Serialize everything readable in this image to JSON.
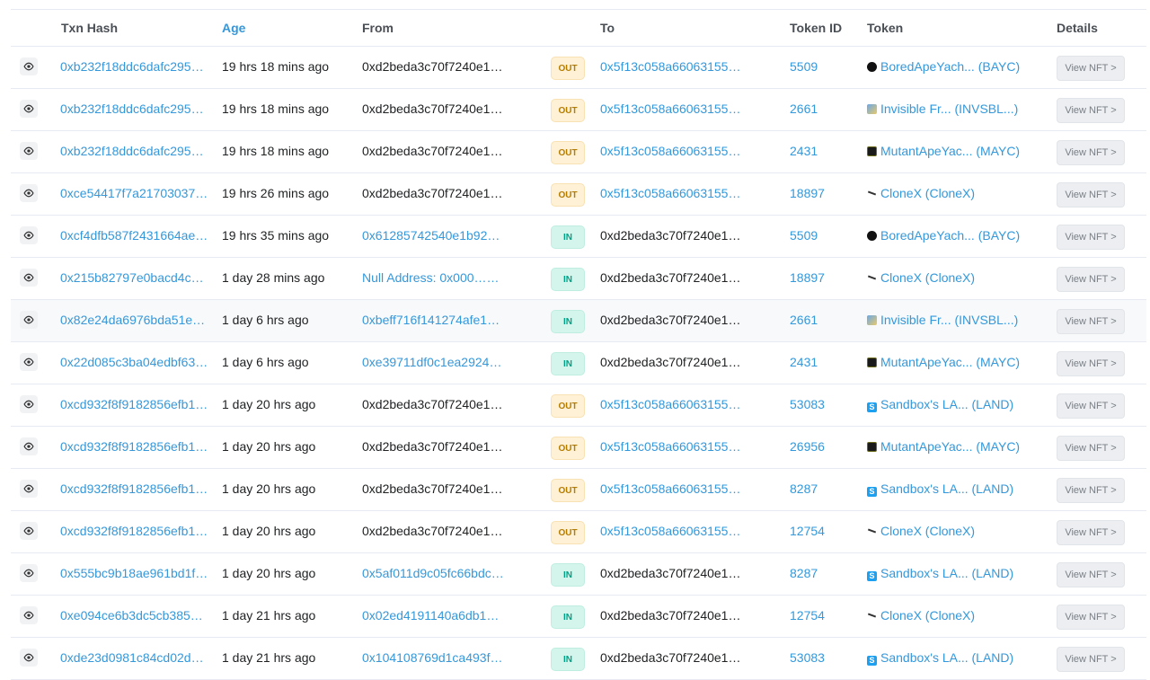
{
  "columns": {
    "txn_hash": "Txn Hash",
    "age": "Age",
    "from": "From",
    "to": "To",
    "token_id": "Token ID",
    "token": "Token",
    "details": "Details"
  },
  "view_nft_label": "View NFT >",
  "rows": [
    {
      "hash": "0xb232f18ddc6dafc2957…",
      "age": "19 hrs 18 mins ago",
      "from": "0xd2beda3c70f7240e1c…",
      "from_link": false,
      "dir": "OUT",
      "to": "0x5f13c058a660631558…",
      "to_link": true,
      "token_id": "5509",
      "token": "BoredApeYach... (BAYC)",
      "icon": "bayc-icon"
    },
    {
      "hash": "0xb232f18ddc6dafc2957…",
      "age": "19 hrs 18 mins ago",
      "from": "0xd2beda3c70f7240e1c…",
      "from_link": false,
      "dir": "OUT",
      "to": "0x5f13c058a660631558…",
      "to_link": true,
      "token_id": "2661",
      "token": "Invisible Fr... (INVSBL...)",
      "icon": "invisible-friends-icon"
    },
    {
      "hash": "0xb232f18ddc6dafc2957…",
      "age": "19 hrs 18 mins ago",
      "from": "0xd2beda3c70f7240e1c…",
      "from_link": false,
      "dir": "OUT",
      "to": "0x5f13c058a660631558…",
      "to_link": true,
      "token_id": "2431",
      "token": "MutantApeYac... (MAYC)",
      "icon": "mayc-icon"
    },
    {
      "hash": "0xce54417f7a21703037…",
      "age": "19 hrs 26 mins ago",
      "from": "0xd2beda3c70f7240e1c…",
      "from_link": false,
      "dir": "OUT",
      "to": "0x5f13c058a660631558…",
      "to_link": true,
      "token_id": "18897",
      "token": "CloneX (CloneX)",
      "icon": "clonex-icon"
    },
    {
      "hash": "0xcf4dfb587f2431664ae…",
      "age": "19 hrs 35 mins ago",
      "from": "0x61285742540e1b92e3…",
      "from_link": true,
      "dir": "IN",
      "to": "0xd2beda3c70f7240e1c…",
      "to_link": false,
      "token_id": "5509",
      "token": "BoredApeYach... (BAYC)",
      "icon": "bayc-icon"
    },
    {
      "hash": "0x215b82797e0bacd4c3…",
      "age": "1 day 28 mins ago",
      "from": "Null Address: 0x000…000",
      "from_link": true,
      "dir": "IN",
      "to": "0xd2beda3c70f7240e1c…",
      "to_link": false,
      "token_id": "18897",
      "token": "CloneX (CloneX)",
      "icon": "clonex-icon"
    },
    {
      "hash": "0x82e24da6976bda51e0…",
      "age": "1 day 6 hrs ago",
      "from": "0xbeff716f141274afe1d1…",
      "from_link": true,
      "dir": "IN",
      "to": "0xd2beda3c70f7240e1c…",
      "to_link": false,
      "token_id": "2661",
      "token": "Invisible Fr... (INVSBL...)",
      "icon": "invisible-friends-icon",
      "highlight": true
    },
    {
      "hash": "0x22d085c3ba04edbf63…",
      "age": "1 day 6 hrs ago",
      "from": "0xe39711df0c1ea29247…",
      "from_link": true,
      "dir": "IN",
      "to": "0xd2beda3c70f7240e1c…",
      "to_link": false,
      "token_id": "2431",
      "token": "MutantApeYac... (MAYC)",
      "icon": "mayc-icon"
    },
    {
      "hash": "0xcd932f8f9182856efb1f…",
      "age": "1 day 20 hrs ago",
      "from": "0xd2beda3c70f7240e1c…",
      "from_link": false,
      "dir": "OUT",
      "to": "0x5f13c058a660631558…",
      "to_link": true,
      "token_id": "53083",
      "token": "Sandbox's LA... (LAND)",
      "icon": "sandbox-land-icon"
    },
    {
      "hash": "0xcd932f8f9182856efb1f…",
      "age": "1 day 20 hrs ago",
      "from": "0xd2beda3c70f7240e1c…",
      "from_link": false,
      "dir": "OUT",
      "to": "0x5f13c058a660631558…",
      "to_link": true,
      "token_id": "26956",
      "token": "MutantApeYac... (MAYC)",
      "icon": "mayc-icon"
    },
    {
      "hash": "0xcd932f8f9182856efb1f…",
      "age": "1 day 20 hrs ago",
      "from": "0xd2beda3c70f7240e1c…",
      "from_link": false,
      "dir": "OUT",
      "to": "0x5f13c058a660631558…",
      "to_link": true,
      "token_id": "8287",
      "token": "Sandbox's LA... (LAND)",
      "icon": "sandbox-land-icon"
    },
    {
      "hash": "0xcd932f8f9182856efb1f…",
      "age": "1 day 20 hrs ago",
      "from": "0xd2beda3c70f7240e1c…",
      "from_link": false,
      "dir": "OUT",
      "to": "0x5f13c058a660631558…",
      "to_link": true,
      "token_id": "12754",
      "token": "CloneX (CloneX)",
      "icon": "clonex-icon"
    },
    {
      "hash": "0x555bc9b18ae961bd1f…",
      "age": "1 day 20 hrs ago",
      "from": "0x5af011d9c05fc66bdc1…",
      "from_link": true,
      "dir": "IN",
      "to": "0xd2beda3c70f7240e1c…",
      "to_link": false,
      "token_id": "8287",
      "token": "Sandbox's LA... (LAND)",
      "icon": "sandbox-land-icon"
    },
    {
      "hash": "0xe094ce6b3dc5cb385e…",
      "age": "1 day 21 hrs ago",
      "from": "0x02ed4191140a6db15c…",
      "from_link": true,
      "dir": "IN",
      "to": "0xd2beda3c70f7240e1c…",
      "to_link": false,
      "token_id": "12754",
      "token": "CloneX (CloneX)",
      "icon": "clonex-icon"
    },
    {
      "hash": "0xde23d0981c84cd02de…",
      "age": "1 day 21 hrs ago",
      "from": "0x104108769d1ca493fe…",
      "from_link": true,
      "dir": "IN",
      "to": "0xd2beda3c70f7240e1c…",
      "to_link": false,
      "token_id": "53083",
      "token": "Sandbox's LA... (LAND)",
      "icon": "sandbox-land-icon"
    }
  ]
}
